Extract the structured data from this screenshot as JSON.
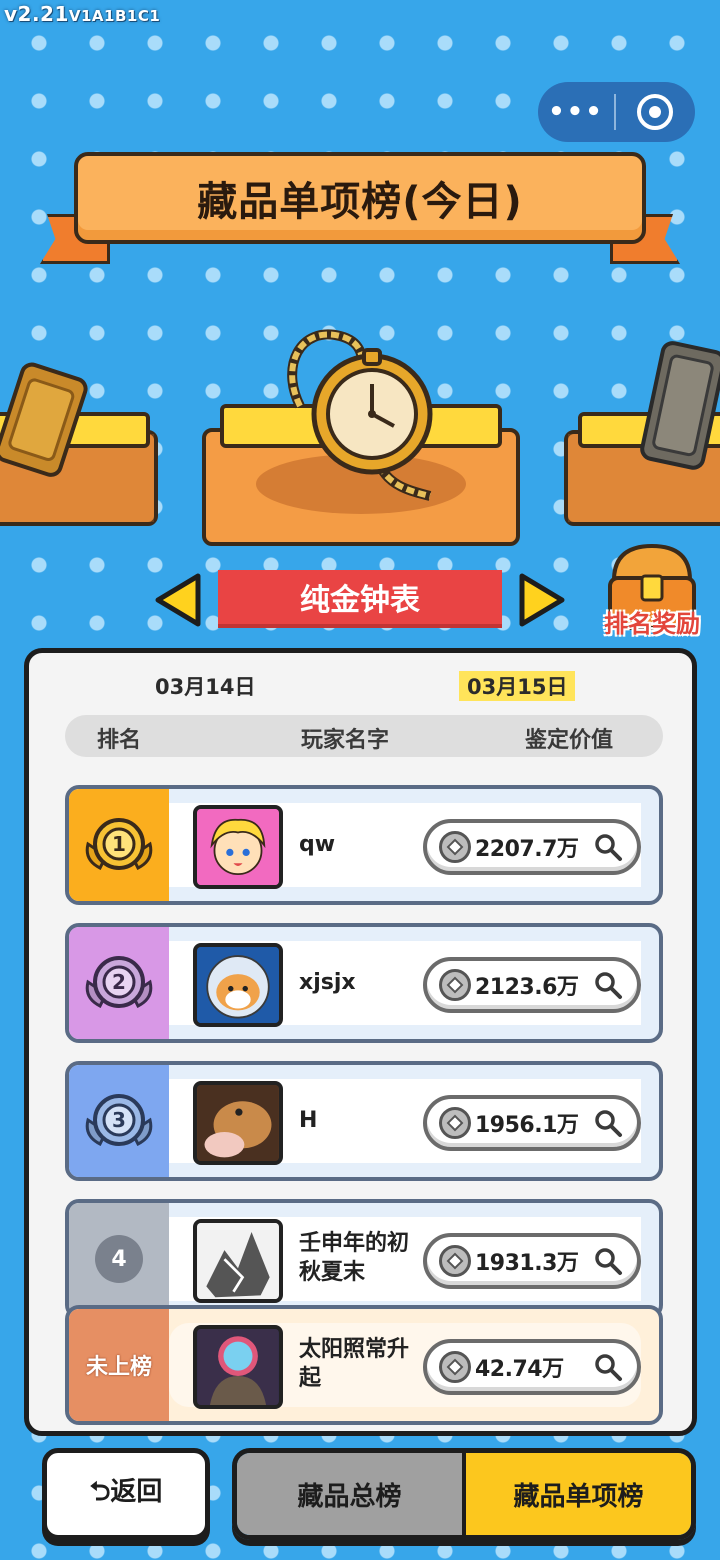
{
  "version": {
    "main": "v2.21",
    "build": "V1A1B1C1"
  },
  "capsule": {
    "menu_icon": "more-dots-icon",
    "close_icon": "target-circle-icon"
  },
  "banner": {
    "title": "藏品单项榜(今日)"
  },
  "item": {
    "name": "纯金钟表"
  },
  "reward": {
    "label": "排名奖励"
  },
  "dates": {
    "prev": "03月14日",
    "current": "03月15日"
  },
  "columns": {
    "rank": "排名",
    "player": "玩家名字",
    "value": "鉴定价值"
  },
  "rows": [
    {
      "rank": "1",
      "player": "qw",
      "value": "2207.7万"
    },
    {
      "rank": "2",
      "player": "xjsjx",
      "value": "2123.6万"
    },
    {
      "rank": "3",
      "player": "H",
      "value": "1956.1万"
    },
    {
      "rank": "4",
      "player": "壬申年的初秋夏末",
      "value": "1931.3万"
    }
  ],
  "self": {
    "rank": "未上榜",
    "player": "太阳照常升起",
    "value": "42.74万"
  },
  "bottom": {
    "back": "⮌返回",
    "tab_total": "藏品总榜",
    "tab_single": "藏品单项榜"
  },
  "colors": {
    "background": "#37a6ea",
    "rank1": "#fbae1e",
    "rank2": "#d898e6",
    "rank3": "#7ea7f0",
    "rank4": "#b2b9c3",
    "self": "#e68f63",
    "active_tab": "#fcc71e",
    "item_plate": "#e94444"
  }
}
